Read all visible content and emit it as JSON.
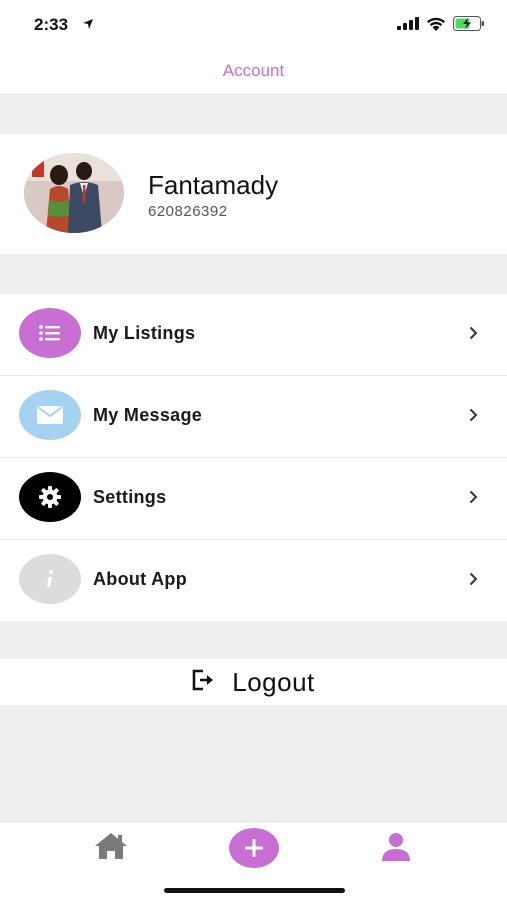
{
  "status_bar": {
    "time": "2:33",
    "icons": [
      "location-arrow-icon",
      "signal-icon",
      "wifi-icon",
      "battery-charging-icon"
    ]
  },
  "nav": {
    "title": "Account"
  },
  "profile": {
    "name": "Fantamady",
    "phone": "620826392"
  },
  "menu": {
    "items": [
      {
        "label": "My Listings",
        "icon": "list-icon",
        "color": "#c76fd3"
      },
      {
        "label": "My Message",
        "icon": "envelope-icon",
        "color": "#a6d2f2"
      },
      {
        "label": "Settings",
        "icon": "gear-icon",
        "color": "#000000"
      },
      {
        "label": "About App",
        "icon": "info-icon",
        "color": "#dcdcdc"
      }
    ]
  },
  "logout": {
    "label": "Logout",
    "icon": "sign-out-icon"
  },
  "tab_bar": {
    "items": [
      "home-icon",
      "add-icon",
      "profile-icon"
    ],
    "active": "profile-icon",
    "accent": "#c76fd3",
    "inactive": "#7a7a7a"
  }
}
